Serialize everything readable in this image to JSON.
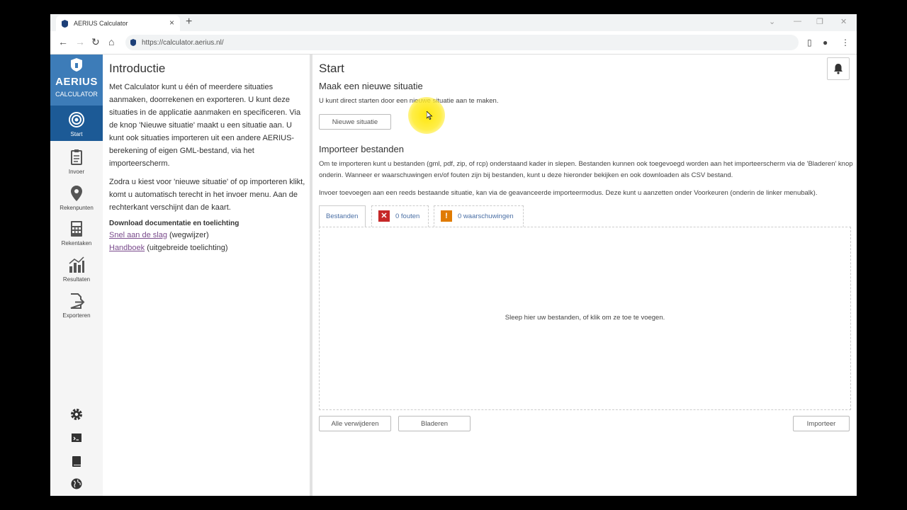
{
  "browser": {
    "tab_title": "AERIUS Calculator",
    "url": "https://calculator.aerius.nl/"
  },
  "sidebar": {
    "logo_name": "AERIUS",
    "logo_sub": "CALCULATOR",
    "items": [
      {
        "label": "Start",
        "icon": "target-icon",
        "active": true
      },
      {
        "label": "Invoer",
        "icon": "clipboard-icon"
      },
      {
        "label": "Rekenpunten",
        "icon": "map-pin-icon"
      },
      {
        "label": "Rekentaken",
        "icon": "calculator-icon"
      },
      {
        "label": "Resultaten",
        "icon": "bar-chart-icon"
      },
      {
        "label": "Exporteren",
        "icon": "export-icon"
      }
    ],
    "bottom_icons": [
      "gear-icon",
      "terminal-icon",
      "book-icon",
      "globe-icon"
    ]
  },
  "intro": {
    "title": "Introductie",
    "p1": "Met Calculator kunt u één of meerdere situaties aanmaken, doorrekenen en exporteren. U kunt deze situaties in de applicatie aanmaken en specificeren. Via de knop 'Nieuwe situatie' maakt u een situatie aan. U kunt ook situaties importeren uit een andere AERIUS-berekening of eigen GML-bestand, via het importeerscherm.",
    "p2": "Zodra u kiest voor 'nieuwe situatie' of op importeren klikt, komt u automatisch terecht in het invoer menu. Aan de rechterkant verschijnt dan de kaart.",
    "download_heading": "Download documentatie en toelichting",
    "link1": "Snel aan de slag",
    "link1_suffix": " (wegwijzer)",
    "link2": "Handboek",
    "link2_suffix": " (uitgebreide toelichting)"
  },
  "main": {
    "title": "Start",
    "new_heading": "Maak een nieuwe situatie",
    "new_text": "U kunt direct starten door een nieuwe situatie aan te maken.",
    "new_button": "Nieuwe situatie",
    "import_heading": "Importeer bestanden",
    "import_text1": "Om te importeren kunt u bestanden (gml, pdf, zip, of rcp) onderstaand kader in slepen. Bestanden kunnen ook toegevoegd worden aan het importeerscherm via de 'Bladeren' knop onderin. Wanneer er waarschuwingen en/of fouten zijn bij bestanden, kunt u deze hieronder bekijken en ook downloaden als CSV bestand.",
    "import_text2": "Invoer toevoegen aan een reeds bestaande situatie, kan via de geavanceerde importeermodus. Deze kunt u aanzetten onder Voorkeuren (onderin de linker menubalk).",
    "tabs": {
      "files": "Bestanden",
      "errors": "0 fouten",
      "warnings": "0 waarschuwingen"
    },
    "drop_message": "Sleep hier uw bestanden, of klik om ze toe te voegen.",
    "btn_remove_all": "Alle verwijderen",
    "btn_browse": "Bladeren",
    "btn_import": "Importeer"
  },
  "colors": {
    "logo_bg": "#3d7cb8",
    "active_nav": "#1c5a96",
    "error": "#c62828",
    "warning": "#e07b00"
  }
}
